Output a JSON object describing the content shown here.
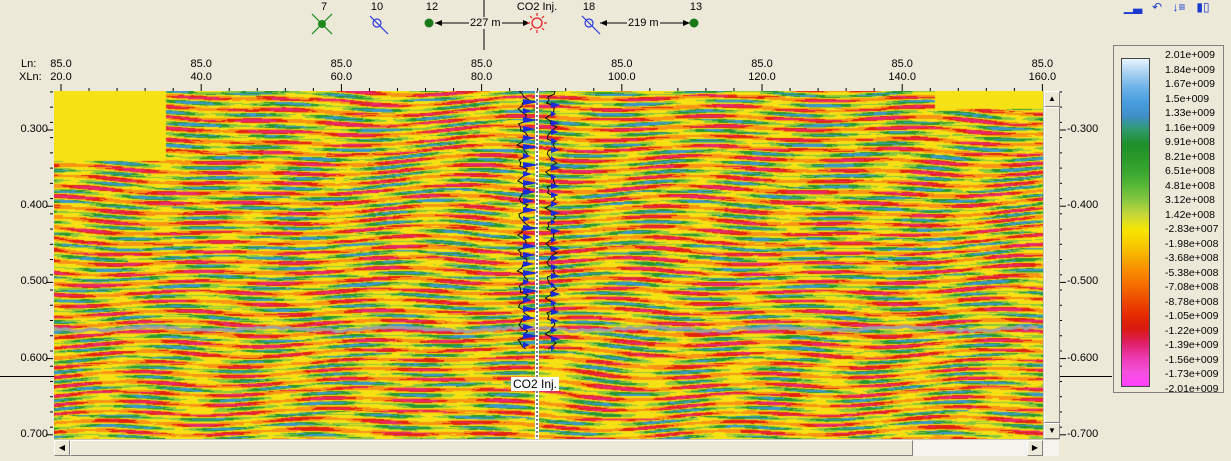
{
  "wells_top": [
    {
      "id": "w7",
      "label": "7",
      "symbol": "x-green"
    },
    {
      "id": "w10",
      "label": "10",
      "symbol": "circle-blue-slash"
    },
    {
      "id": "w12",
      "label": "12",
      "symbol": "dot-green"
    },
    {
      "id": "wco2",
      "label": "CO2 Inj.",
      "symbol": "sun-red"
    },
    {
      "id": "w18",
      "label": "18",
      "symbol": "circle-blue-slash"
    },
    {
      "id": "w13",
      "label": "13",
      "symbol": "dot-green"
    }
  ],
  "distances": [
    {
      "label": "227 m"
    },
    {
      "label": "219 m"
    }
  ],
  "axis_labels": {
    "ln": "Ln:",
    "xln": "XLn:"
  },
  "top_ticks": [
    {
      "ln": "85.0",
      "xln": "20.0"
    },
    {
      "ln": "85.0",
      "xln": "40.0"
    },
    {
      "ln": "85.0",
      "xln": "60.0"
    },
    {
      "ln": "85.0",
      "xln": "80.0"
    },
    {
      "ln": "85.0",
      "xln": "100.0"
    },
    {
      "ln": "85.0",
      "xln": "120.0"
    },
    {
      "ln": "85.0",
      "xln": "140.0"
    },
    {
      "ln": "85.0",
      "xln": "160.0"
    }
  ],
  "time_ticks_left": [
    "0.300",
    "0.400",
    "0.500",
    "0.600",
    "0.700"
  ],
  "time_ticks_right": [
    "-0.300",
    "-0.400",
    "-0.500",
    "-0.600",
    "-0.700"
  ],
  "well_marker_label": "CO2 Inj.",
  "colorbar": {
    "labels": [
      "2.01e+009",
      "1.84e+009",
      "1.67e+009",
      "1.5e+009",
      "1.33e+009",
      "1.16e+009",
      "9.91e+008",
      "8.21e+008",
      "6.51e+008",
      "4.81e+008",
      "3.12e+008",
      "1.42e+008",
      "-2.83e+007",
      "-1.98e+008",
      "-3.68e+008",
      "-5.38e+008",
      "-7.08e+008",
      "-8.78e+008",
      "-1.05e+009",
      "-1.22e+009",
      "-1.39e+009",
      "-1.56e+009",
      "-1.73e+009",
      "-2.01e+009"
    ],
    "stops": [
      "#e8f4ff",
      "#a8d0f0",
      "#6eb2e8",
      "#4a9ee0",
      "#3f8fc8",
      "#2f9a6a",
      "#1f8f2a",
      "#2a9b2a",
      "#3aa830",
      "#5cb838",
      "#8cc840",
      "#c8d838",
      "#f6e600",
      "#f8cc00",
      "#f8aa00",
      "#f88800",
      "#f46a00",
      "#ee4a00",
      "#e62a00",
      "#d81a10",
      "#e0206a",
      "#ec3ab0",
      "#f450dc",
      "#ff40ff"
    ]
  },
  "toolbar": [
    {
      "name": "bar-chart-icon",
      "glyph": "▁▃"
    },
    {
      "name": "undo-icon",
      "glyph": "↶"
    },
    {
      "name": "sort-icon",
      "glyph": "↓≡"
    },
    {
      "name": "histogram-icon",
      "glyph": "▮▯"
    }
  ],
  "scroll_glyphs": {
    "up": "▲",
    "down": "▼",
    "left": "◀",
    "right": "▶"
  }
}
